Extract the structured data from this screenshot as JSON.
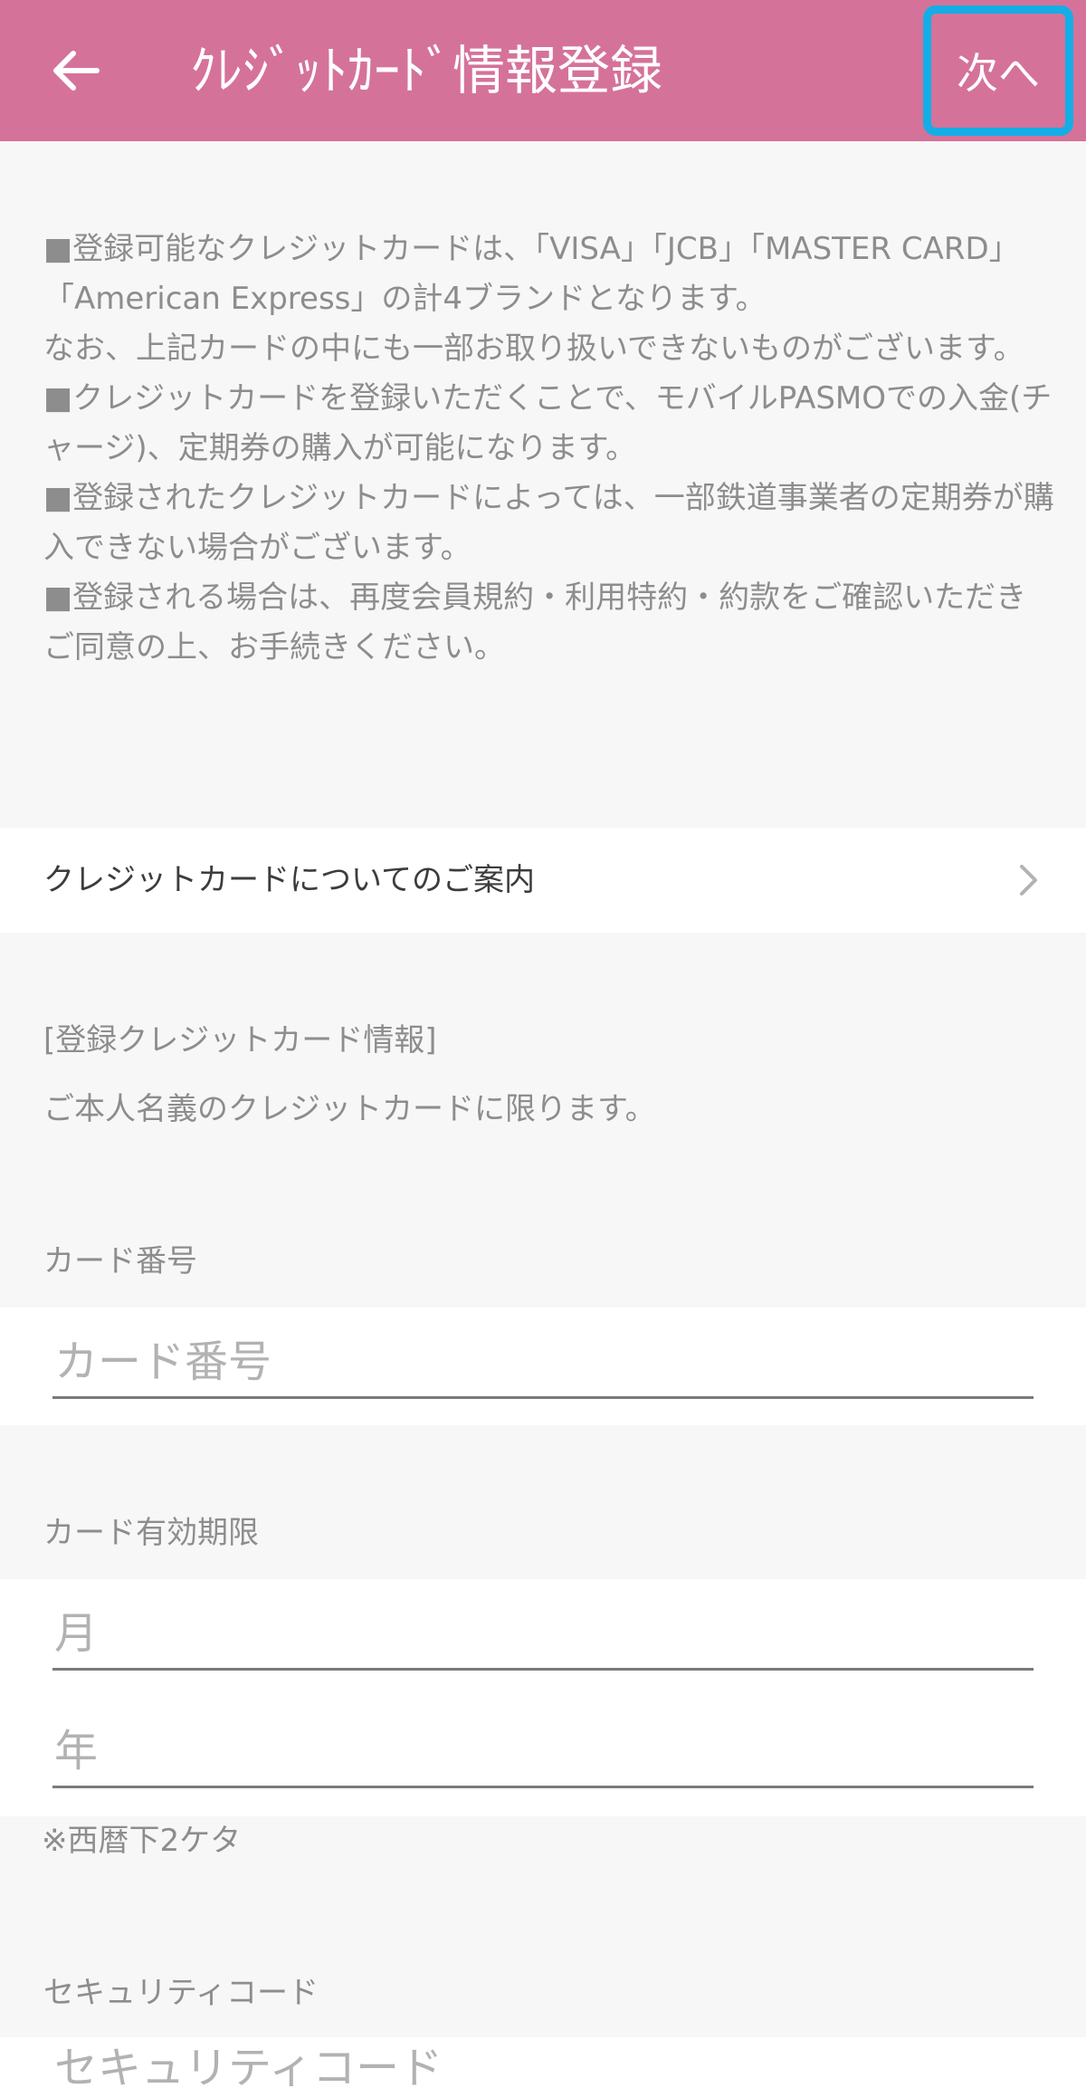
{
  "appbar": {
    "title": "ｸﾚｼﾞｯﾄｶｰﾄﾞ情報登録",
    "back_icon": "arrow-left-icon",
    "next_label": "次へ",
    "background": "#d5729a",
    "highlight_color": "#13aee6"
  },
  "notice": {
    "lines": [
      "■登録可能なクレジットカードは、「VISA」「JCB」「MASTER CARD」「American Express」の計4ブランドとなります。",
      "なお、上記カードの中にも一部お取り扱いできないものがございます。",
      "■クレジットカードを登録いただくことで、モバイルPASMOでの入金(チャージ)、定期券の購入が可能になります。",
      "■登録されたクレジットカードによっては、一部鉄道事業者の定期券が購入できない場合がございます。",
      "■登録される場合は、再度会員規約・利用特約・約款をご確認いただきご同意の上、お手続きください。"
    ]
  },
  "guide_link": {
    "label": "クレジットカードについてのご案内",
    "icon": "chevron-right-icon"
  },
  "card_info": {
    "heading": "[登録クレジットカード情報]",
    "subtext": "ご本人名義のクレジットカードに限ります。"
  },
  "card_number": {
    "label": "カード番号",
    "placeholder": "カード番号"
  },
  "expiry": {
    "label": "カード有効期限",
    "month_placeholder": "月",
    "year_placeholder": "年",
    "note": "※西暦下2ケタ"
  },
  "security_code": {
    "label": "セキュリティコード",
    "placeholder": "セキュリティコード"
  }
}
